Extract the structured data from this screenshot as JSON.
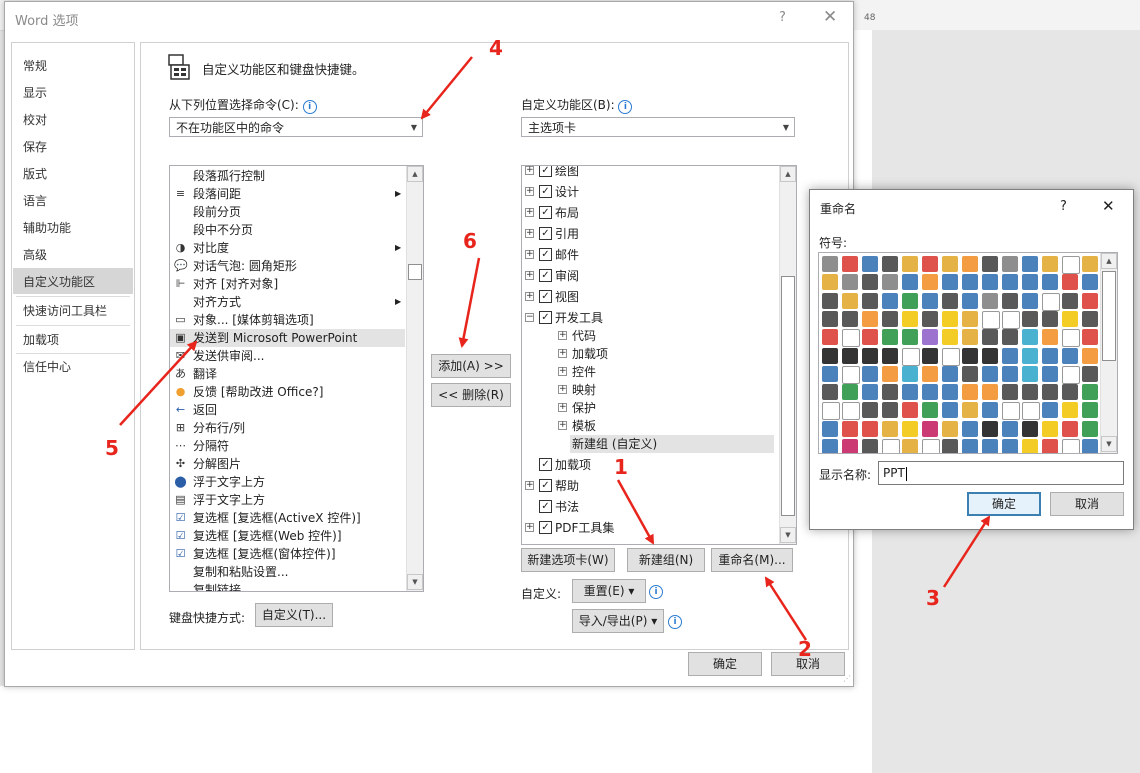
{
  "background": {
    "ruler_number": "48"
  },
  "dialog": {
    "title": "Word 选项",
    "help": "?",
    "close": "✕",
    "nav": [
      "常规",
      "显示",
      "校对",
      "保存",
      "版式",
      "语言",
      "辅助功能",
      "高级",
      "自定义功能区",
      "快速访问工具栏",
      "加载项",
      "信任中心"
    ],
    "nav_selected": "自定义功能区",
    "heading": "自定义功能区和键盘快捷键。",
    "left_label": "从下列位置选择命令(C):",
    "left_combo": "不在功能区中的命令",
    "right_label": "自定义功能区(B):",
    "right_combo": "主选项卡",
    "commands": [
      {
        "label": "段落孤行控制",
        "icon": ""
      },
      {
        "label": "段落间距",
        "icon": "≡",
        "submenu": true
      },
      {
        "label": "段前分页",
        "icon": ""
      },
      {
        "label": "段中不分页",
        "icon": ""
      },
      {
        "label": "对比度",
        "icon": "◑",
        "submenu": true
      },
      {
        "label": "对话气泡: 圆角矩形",
        "icon": "💬"
      },
      {
        "label": "对齐 [对齐对象]",
        "icon": "⊩"
      },
      {
        "label": "对齐方式",
        "icon": "",
        "submenu": true
      },
      {
        "label": "对象... [媒体剪辑选项]",
        "icon": "▭"
      },
      {
        "label": "发送到 Microsoft PowerPoint",
        "icon": "▣",
        "selected": true
      },
      {
        "label": "发送供审阅...",
        "icon": "✉"
      },
      {
        "label": "翻译",
        "icon": "あ"
      },
      {
        "label": "反馈 [帮助改进 Office?]",
        "icon": "●"
      },
      {
        "label": "返回",
        "icon": "←"
      },
      {
        "label": "分布行/列",
        "icon": "⊞"
      },
      {
        "label": "分隔符",
        "icon": "⋯"
      },
      {
        "label": "分解图片",
        "icon": "✣"
      },
      {
        "label": "浮于文字上方",
        "icon": "⬤"
      },
      {
        "label": "浮于文字上方",
        "icon": "▤"
      },
      {
        "label": "复选框 [复选框(ActiveX 控件)]",
        "icon": "☑"
      },
      {
        "label": "复选框 [复选框(Web 控件)]",
        "icon": "☑"
      },
      {
        "label": "复选框 [复选框(窗体控件)]",
        "icon": "☑"
      },
      {
        "label": "复制和粘贴设置...",
        "icon": ""
      },
      {
        "label": "复制链接",
        "icon": ""
      }
    ],
    "add_button": "添加(A) >>",
    "remove_button": "<< 删除(R)",
    "tree": [
      {
        "label": "绘图",
        "level": 0,
        "expand": "+",
        "checked": true
      },
      {
        "label": "设计",
        "level": 0,
        "expand": "+",
        "checked": true
      },
      {
        "label": "布局",
        "level": 0,
        "expand": "+",
        "checked": true
      },
      {
        "label": "引用",
        "level": 0,
        "expand": "+",
        "checked": true
      },
      {
        "label": "邮件",
        "level": 0,
        "expand": "+",
        "checked": true
      },
      {
        "label": "审阅",
        "level": 0,
        "expand": "+",
        "checked": true
      },
      {
        "label": "视图",
        "level": 0,
        "expand": "+",
        "checked": true
      },
      {
        "label": "开发工具",
        "level": 0,
        "expand": "−",
        "checked": true
      },
      {
        "label": "代码",
        "level": 1,
        "expand": "+"
      },
      {
        "label": "加载项",
        "level": 1,
        "expand": "+"
      },
      {
        "label": "控件",
        "level": 1,
        "expand": "+"
      },
      {
        "label": "映射",
        "level": 1,
        "expand": "+"
      },
      {
        "label": "保护",
        "level": 1,
        "expand": "+"
      },
      {
        "label": "模板",
        "level": 1,
        "expand": "+"
      },
      {
        "label": "新建组 (自定义)",
        "level": 1,
        "expand": "",
        "selected": true
      },
      {
        "label": "加载项",
        "level": 0,
        "expand": "",
        "checked": true
      },
      {
        "label": "帮助",
        "level": 0,
        "expand": "+",
        "checked": true
      },
      {
        "label": "书法",
        "level": 0,
        "expand": "",
        "checked": true
      },
      {
        "label": "PDF工具集",
        "level": 0,
        "expand": "+",
        "checked": true
      }
    ],
    "new_tab_button": "新建选项卡(W)",
    "new_group_button": "新建组(N)",
    "rename_button": "重命名(M)...",
    "customize_label": "自定义:",
    "reset_button": "重置(E) ▾",
    "import_export_button": "导入/导出(P) ▾",
    "keyboard_label": "键盘快捷方式:",
    "keyboard_button": "自定义(T)...",
    "ok_button": "确定",
    "cancel_button": "取消"
  },
  "rename_dialog": {
    "title": "重命名",
    "help": "?",
    "close": "✕",
    "symbol_label": "符号:",
    "display_name_label": "显示名称:",
    "display_name_value": "PPT",
    "ok_button": "确定",
    "cancel_button": "取消"
  },
  "annotations": [
    "1",
    "2",
    "3",
    "4",
    "5",
    "6"
  ],
  "colors": {
    "annotation": "#e8251c",
    "selection": "#e3e3e3",
    "default_button_border": "#3c7fb1",
    "info_blue": "#2b7bd1"
  }
}
